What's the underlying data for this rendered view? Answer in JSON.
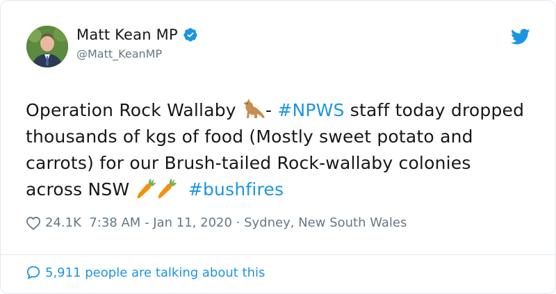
{
  "tweet": {
    "display_name": "Matt Kean MP",
    "handle": "@Matt_KeanMP",
    "text": {
      "part1": "Operation Rock Wallaby ",
      "part2": "- ",
      "hashtag1": "#NPWS",
      "part3": " staff today dropped thousands of kgs of food (Mostly sweet potato and carrots) for our Brush-tailed Rock-wallaby colonies across NSW ",
      "hashtag2": "#bushfires"
    },
    "icons": [
      "verified-badge-icon",
      "twitter-bird-icon",
      "kangaroo-emoji",
      "carrot-emoji",
      "heart-icon",
      "speech-bubble-icon"
    ]
  },
  "meta": {
    "likes": "24.1K",
    "time": "7:38 AM",
    "date": "Jan 11, 2020",
    "separator1": " - ",
    "separator2": " · ",
    "location": "Sydney, New South Wales"
  },
  "footer": {
    "talking_label": "5,911 people are talking about this"
  },
  "colors": {
    "accent": "#1b95e0",
    "muted": "#657786",
    "text": "#14171a",
    "border": "#e1e8ed"
  }
}
